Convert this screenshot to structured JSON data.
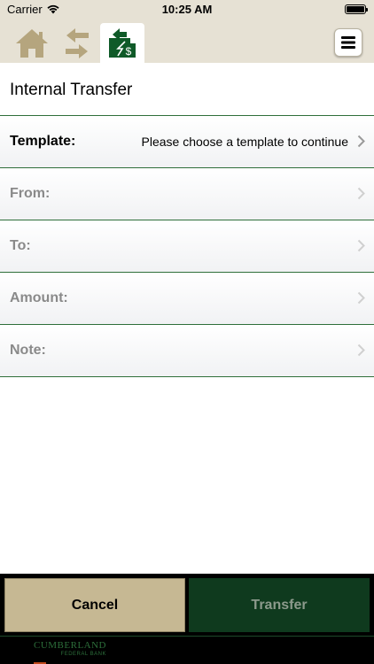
{
  "status_bar": {
    "carrier": "Carrier",
    "time": "10:25 AM",
    "wifi_icon": "wifi-icon",
    "battery_icon": "battery-icon"
  },
  "nav": {
    "items": [
      {
        "name": "home",
        "icon": "home-icon"
      },
      {
        "name": "transfers",
        "icon": "swap-arrows-icon"
      },
      {
        "name": "internal-transfer",
        "icon": "transfer-dollar-icon",
        "selected": true
      }
    ],
    "menu_icon": "hamburger-menu-icon"
  },
  "page": {
    "title": "Internal Transfer"
  },
  "form": {
    "template": {
      "label": "Template:",
      "value": "Please choose a template to continue"
    },
    "from": {
      "label": "From:"
    },
    "to": {
      "label": "To:"
    },
    "amount": {
      "label": "Amount:"
    },
    "note": {
      "label": "Note:"
    }
  },
  "actions": {
    "cancel_label": "Cancel",
    "transfer_label": "Transfer"
  },
  "footer": {
    "logo_name": "CUMBERLAND",
    "logo_sub": "FEDERAL BANK"
  },
  "colors": {
    "nav_background": "#e6e1d4",
    "accent_green": "#2f6f3a",
    "cancel_button": "#c6b893",
    "transfer_button": "#0f3a1e",
    "icon_tan": "#b5a57e"
  }
}
